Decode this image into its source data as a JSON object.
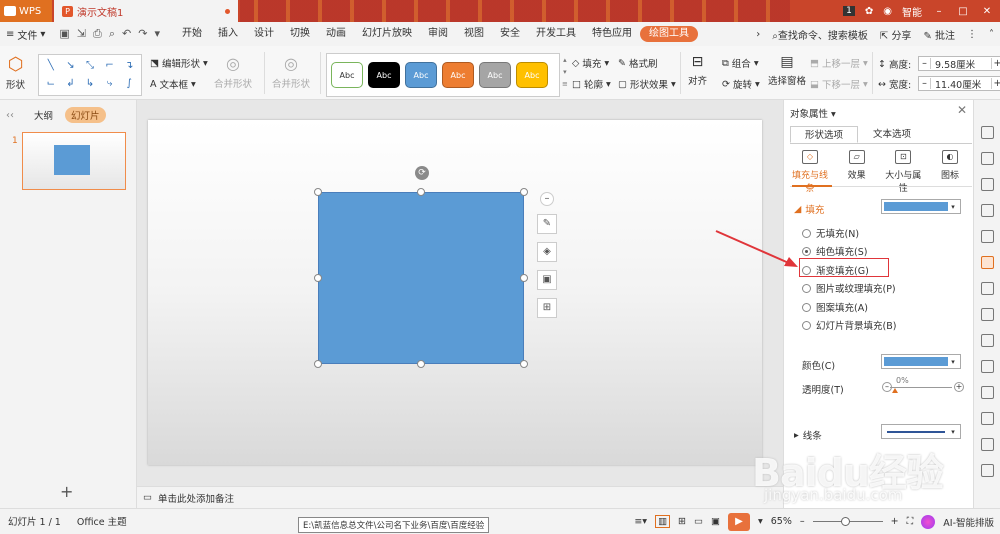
{
  "titlebar": {
    "app": "WPS",
    "doc_tab": "演示文稿1",
    "badge": "1",
    "user": "智能"
  },
  "menubar": {
    "file": "文件",
    "tabs": [
      "开始",
      "插入",
      "设计",
      "切换",
      "动画",
      "幻灯片放映",
      "审阅",
      "视图",
      "安全",
      "开发工具",
      "特色应用",
      "绘图工具"
    ],
    "active_tab": "绘图工具",
    "search": "查找命令、搜索模板",
    "share": "分享",
    "comment": "批注"
  },
  "ribbon": {
    "shape": "形状",
    "edit_shape": "编辑形状",
    "textbox": "文本框",
    "merge_shape": "合并形状",
    "merge_shape2": "合并形状",
    "style_label": "Abc",
    "styles": [
      {
        "bg": "#ffffff",
        "fg": "#333333",
        "border": "#7ab55c"
      },
      {
        "bg": "#000000",
        "fg": "#ffffff",
        "border": "#000000"
      },
      {
        "bg": "#5b9bd5",
        "fg": "#ffffff",
        "border": "#41719c"
      },
      {
        "bg": "#ed7d31",
        "fg": "#ffffff",
        "border": "#ae5a21"
      },
      {
        "bg": "#a5a5a5",
        "fg": "#ffffff",
        "border": "#787878"
      },
      {
        "bg": "#ffc000",
        "fg": "#ffffff",
        "border": "#bc8c00"
      }
    ],
    "fill": "填充",
    "format_painter": "格式刷",
    "outline": "轮廓",
    "shape_effect": "形状效果",
    "align": "对齐",
    "group": "组合",
    "rotate": "旋转",
    "selection_pane": "选择窗格",
    "bring_forward": "上移一层",
    "send_backward": "下移一层",
    "height_label": "高度:",
    "height_value": "9.58厘米",
    "width_label": "宽度:",
    "width_value": "11.40厘米"
  },
  "left_panel": {
    "tab_outline": "大纲",
    "tab_slides": "幻灯片",
    "slide_number": "1",
    "add": "+"
  },
  "notes": {
    "placeholder": "单击此处添加备注"
  },
  "right_panel": {
    "title": "对象属性",
    "tabs": [
      "形状选项",
      "文本选项"
    ],
    "subtabs": [
      "填充与线条",
      "效果",
      "大小与属性",
      "图标"
    ],
    "fill_section": "填充",
    "fill_options": [
      "无填充(N)",
      "纯色填充(S)",
      "渐变填充(G)",
      "图片或纹理填充(P)",
      "图案填充(A)",
      "幻灯片背景填充(B)"
    ],
    "selected_option": "纯色填充(S)",
    "highlighted_option": "渐变填充(G)",
    "color_label": "颜色(C)",
    "transparency_label": "透明度(T)",
    "transparency_value": "0%",
    "line_section": "线条",
    "fill_color": "#5b9bd5",
    "line_color": "#2f5597"
  },
  "status": {
    "slide_info": "幻灯片 1 / 1",
    "theme": "Office 主题",
    "path_tip": "E:\\凯蓝信息总文件\\公司名下业务\\百度\\百度经验",
    "zoom": "65%",
    "ai": "AI-智能排版"
  },
  "watermark": {
    "brand": "Baidu经验",
    "url": "jingyan.baidu.com"
  },
  "colors": {
    "accent": "#e8713c",
    "shape_fill": "#5b9bd5",
    "titlebar": "#c9452a",
    "annotation": "#e0353a"
  }
}
